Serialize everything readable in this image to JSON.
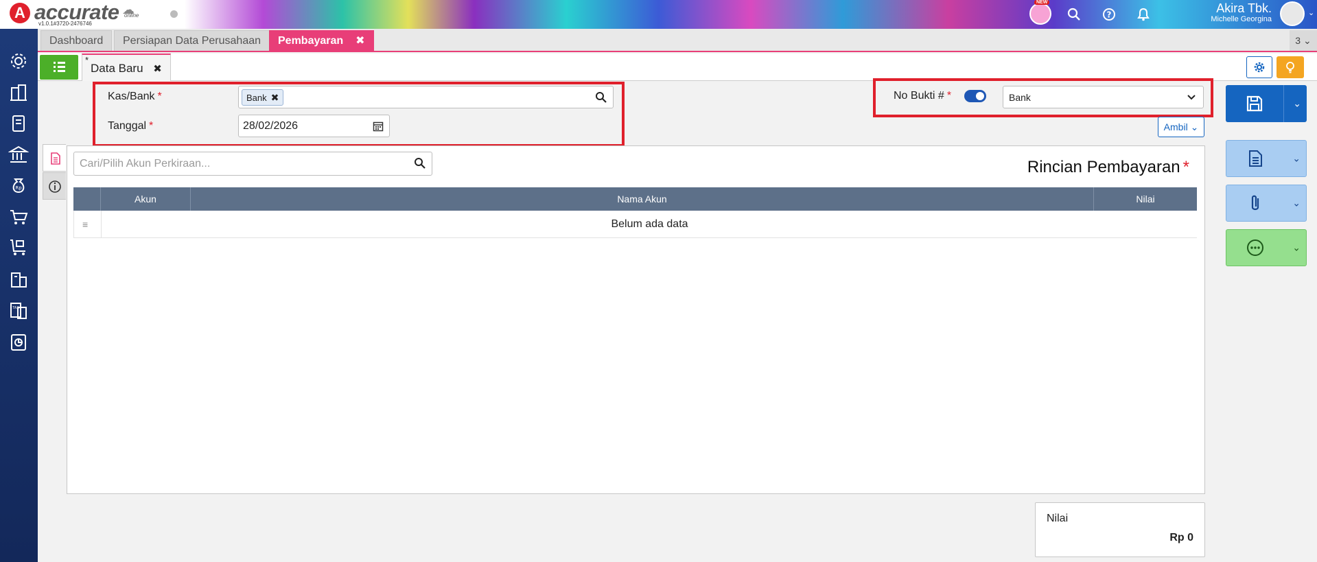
{
  "header": {
    "brand": "accurate",
    "brand_sub": "online",
    "version": "v1.0.1#3720-2476746",
    "new_badge": "NEW",
    "user_name": "Akira Tbk.",
    "user_sub": "Michelle Georgina"
  },
  "sidebar": {
    "icons": [
      "gear-icon",
      "building-icon",
      "book-icon",
      "bank-icon",
      "money-bag-icon",
      "cart-icon",
      "cart-box-icon",
      "warehouse-icon",
      "tax-icon",
      "report-icon"
    ]
  },
  "tabs": {
    "items": [
      {
        "label": "Dashboard"
      },
      {
        "label": "Persiapan Data Perusahaan"
      },
      {
        "label": "Pembayaran"
      }
    ],
    "close": "✖",
    "count": "3"
  },
  "subtab": {
    "star": "*",
    "label": "Data Baru",
    "close": "✖"
  },
  "form": {
    "kas_label": "Kas/Bank",
    "kas_chip": "Bank",
    "tanggal_label": "Tanggal",
    "tanggal_value": "28/02/2026",
    "required_mark": "*",
    "nobukti_label": "No Bukti #",
    "nobukti_value": "Bank",
    "ambil_label": "Ambil"
  },
  "detail": {
    "search_placeholder": "Cari/Pilih Akun Perkiraan...",
    "title": "Rincian Pembayaran",
    "columns": [
      "Akun",
      "Nama Akun",
      "Nilai"
    ],
    "empty_text": "Belum ada data"
  },
  "total": {
    "label": "Nilai",
    "value": "Rp 0"
  },
  "colors": {
    "accent": "#e83e78",
    "primary": "#1565c0",
    "highlight": "#e0202c",
    "sidebar": "#1d3a78"
  }
}
